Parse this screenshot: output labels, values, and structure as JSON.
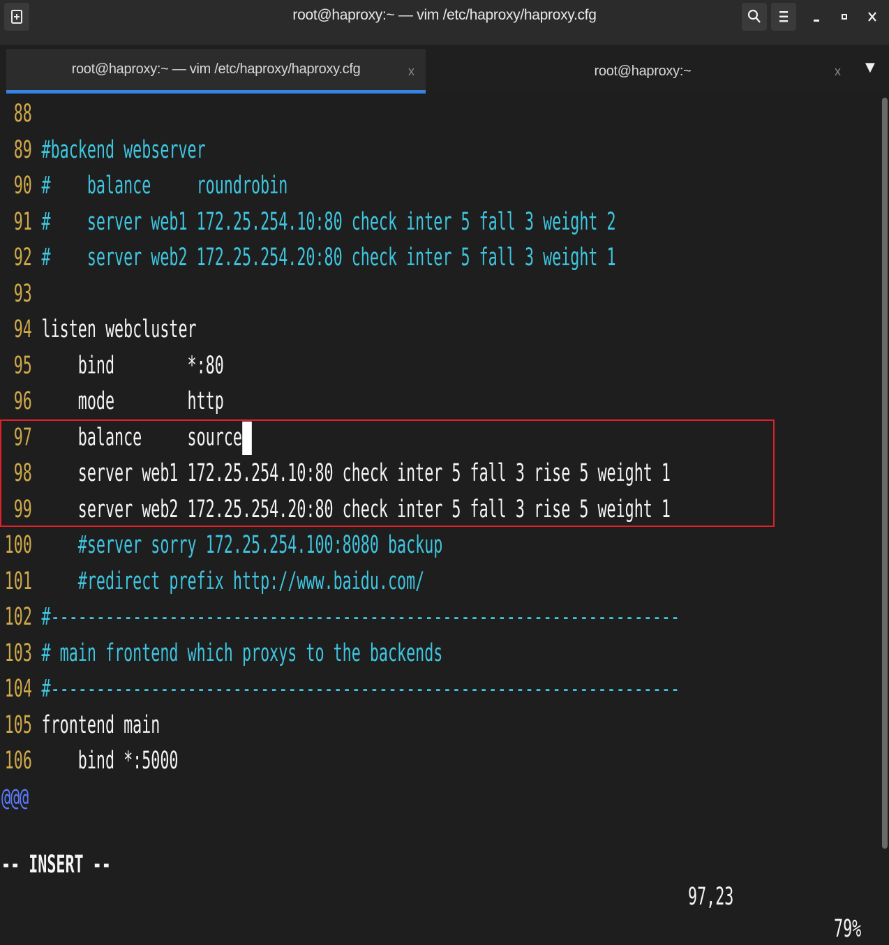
{
  "window": {
    "title": "root@haproxy:~ — vim /etc/haproxy/haproxy.cfg"
  },
  "tabs": [
    {
      "label": "root@haproxy:~ — vim /etc/haproxy/haproxy.cfg",
      "active": true
    },
    {
      "label": "root@haproxy:~",
      "active": false
    }
  ],
  "editor": {
    "lines": [
      {
        "num": "88",
        "text": "",
        "style": "normal"
      },
      {
        "num": "89",
        "text": "#backend webserver",
        "style": "comment"
      },
      {
        "num": "90",
        "text": "#    balance     roundrobin",
        "style": "comment"
      },
      {
        "num": "91",
        "text": "#    server web1 172.25.254.10:80 check inter 5 fall 3 weight 2",
        "style": "comment"
      },
      {
        "num": "92",
        "text": "#    server web2 172.25.254.20:80 check inter 5 fall 3 weight 1",
        "style": "comment"
      },
      {
        "num": "93",
        "text": "",
        "style": "normal"
      },
      {
        "num": "94",
        "text": "listen webcluster",
        "style": "normal"
      },
      {
        "num": "95",
        "text": "    bind        *:80",
        "style": "normal"
      },
      {
        "num": "96",
        "text": "    mode        http",
        "style": "normal"
      },
      {
        "num": "97",
        "text": "    balance     source",
        "style": "normal"
      },
      {
        "num": "98",
        "text": "    server web1 172.25.254.10:80 check inter 5 fall 3 rise 5 weight 1",
        "style": "normal"
      },
      {
        "num": "99",
        "text": "    server web2 172.25.254.20:80 check inter 5 fall 3 rise 5 weight 1",
        "style": "normal"
      },
      {
        "num": "100",
        "text": "    #server sorry 172.25.254.100:8080 backup",
        "style": "comment"
      },
      {
        "num": "101",
        "text": "    #redirect prefix http://www.baidu.com/",
        "style": "comment"
      },
      {
        "num": "102",
        "text": "#---------------------------------------------------------------------",
        "style": "comment"
      },
      {
        "num": "103",
        "text": "# main frontend which proxys to the backends",
        "style": "comment"
      },
      {
        "num": "104",
        "text": "#---------------------------------------------------------------------",
        "style": "comment"
      },
      {
        "num": "105",
        "text": "frontend main",
        "style": "normal"
      },
      {
        "num": "106",
        "text": "    bind *:5000",
        "style": "normal"
      }
    ],
    "overflow_marker": "@@@",
    "cursor_line": 97
  },
  "status": {
    "mode": "-- INSERT --",
    "position": "97,23",
    "percent": "79%"
  },
  "colors": {
    "line_number": "#d0a94a",
    "comment": "#3fc6e0",
    "highlight_box": "#e0202a",
    "active_tab_accent": "#3584e4"
  }
}
